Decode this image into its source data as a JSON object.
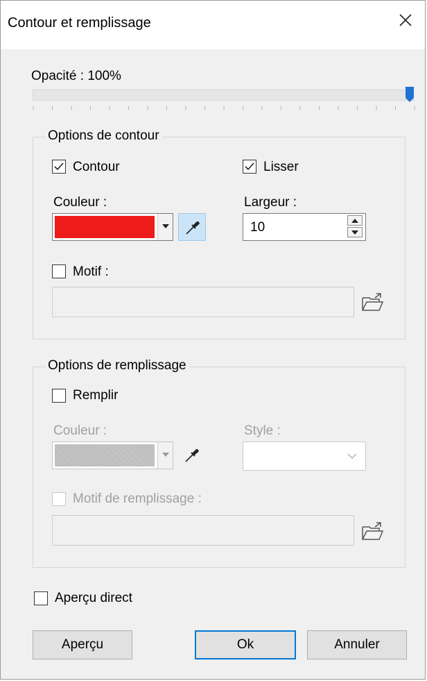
{
  "window": {
    "title": "Contour et remplissage",
    "close_icon": "close-icon"
  },
  "opacity": {
    "label": "Opacité : 100%",
    "value_percent": 100
  },
  "contour_group": {
    "title": "Options de contour",
    "contour_checkbox": {
      "label": "Contour",
      "checked": true
    },
    "lisser_checkbox": {
      "label": "Lisser",
      "checked": true
    },
    "couleur_label": "Couleur :",
    "color_value": "#ee1b1b",
    "largeur_label": "Largeur :",
    "largeur_value": "10",
    "motif_checkbox": {
      "label": "Motif :",
      "checked": false
    },
    "motif_value": ""
  },
  "fill_group": {
    "title": "Options de remplissage",
    "remplir_checkbox": {
      "label": "Remplir",
      "checked": false
    },
    "couleur_label": "Couleur :",
    "style_label": "Style :",
    "style_value": "",
    "motif_checkbox": {
      "label": "Motif de remplissage :",
      "checked": false
    },
    "motif_value": ""
  },
  "live_preview": {
    "label": "Aperçu direct",
    "checked": false
  },
  "buttons": {
    "preview": "Aperçu",
    "ok": "Ok",
    "cancel": "Annuler"
  },
  "colors": {
    "accent": "#0078d7",
    "pipette_active_bg": "#cce4f7",
    "slider_thumb": "#1e73d2"
  }
}
